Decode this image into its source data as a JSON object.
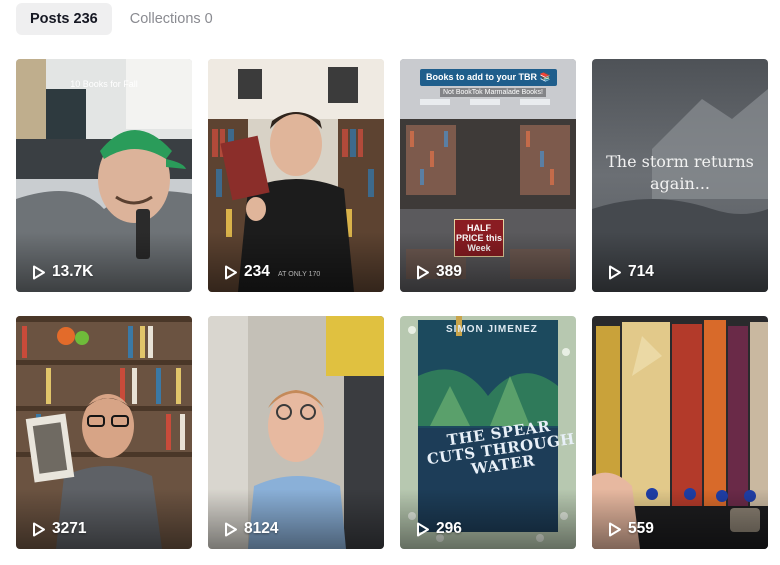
{
  "tabs": [
    {
      "label": "Posts 236",
      "active": true
    },
    {
      "label": "Collections 0",
      "active": false
    }
  ],
  "videos": [
    {
      "views": "13.7K",
      "caption": "10 Books for Fall"
    },
    {
      "views": "234"
    },
    {
      "views": "389",
      "caption": "Books to add to your TBR 📚",
      "subcaption": "Not BookTok Marmalade Books!",
      "sign": "HALF PRICE this Week"
    },
    {
      "views": "714",
      "caption": "The storm returns again..."
    },
    {
      "views": "3271"
    },
    {
      "views": "8124"
    },
    {
      "views": "296",
      "author": "SIMON JIMENEZ",
      "title": "THE SPEAR CUTS THROUGH WATER"
    },
    {
      "views": "559"
    }
  ],
  "colors": {
    "active_tab_bg": "#efeff0",
    "inactive_tab_text": "#8a8b91",
    "view_count_text": "#ffffff"
  },
  "icons": {
    "view_count": "play-icon"
  }
}
